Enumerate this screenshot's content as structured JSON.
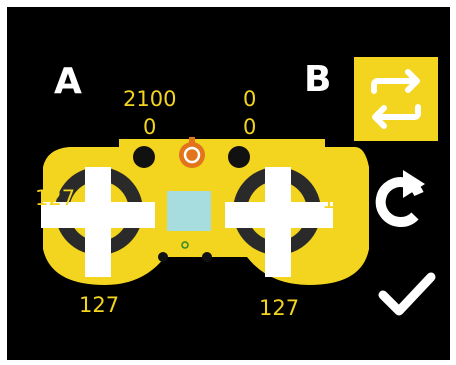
{
  "labels": {
    "side_a": "A",
    "side_b": "B"
  },
  "channels": {
    "top_left_upper": "2100",
    "top_left_lower": "0",
    "top_right_upper": "0",
    "top_right_lower": "0",
    "left_stick_horizontal": "127",
    "right_stick_horizontal": "127",
    "left_stick_vertical": "127",
    "right_stick_vertical": "127"
  },
  "icons": {
    "swap": "swap-arrows-icon",
    "reset": "rotate-reset-icon",
    "confirm": "checkmark-icon",
    "controller": "controller-icon"
  },
  "colors": {
    "background": "#000000",
    "accent": "#f3d41f",
    "controller_body": "#f3d41f",
    "stick": "#ffffff",
    "screen": "#a8dde0",
    "status_led": "#e2741c",
    "icon_white": "#ffffff"
  }
}
